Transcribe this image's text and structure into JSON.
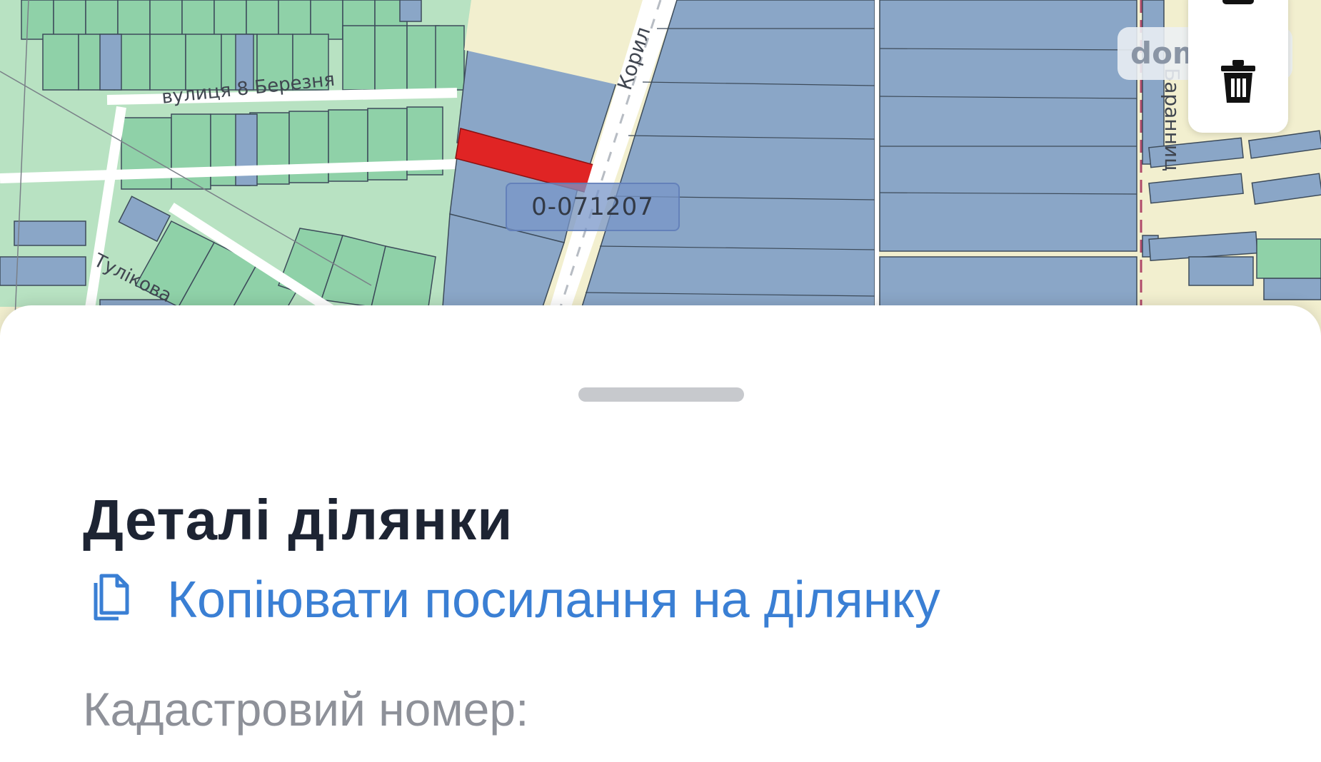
{
  "map": {
    "street_labels": [
      "вулиця 8 Березня",
      "Тулікова",
      "Корил",
      "Баранниц"
    ],
    "parcel_id": "0-071207",
    "watermark": "dom",
    "colors": {
      "background": "#f2efcf",
      "parcel_blue": "#8aa6c7",
      "parcel_green": "#8fd1a8",
      "selected_parcel": "#e02424"
    },
    "icons": [
      "map-tool-icon",
      "trash-icon"
    ]
  },
  "sheet": {
    "title": "Деталі ділянки",
    "copy_link_label": "Копіювати посилання на ділянку",
    "cadastral_label": "Кадастровий номер:",
    "accent_color": "#3a7fd4"
  }
}
